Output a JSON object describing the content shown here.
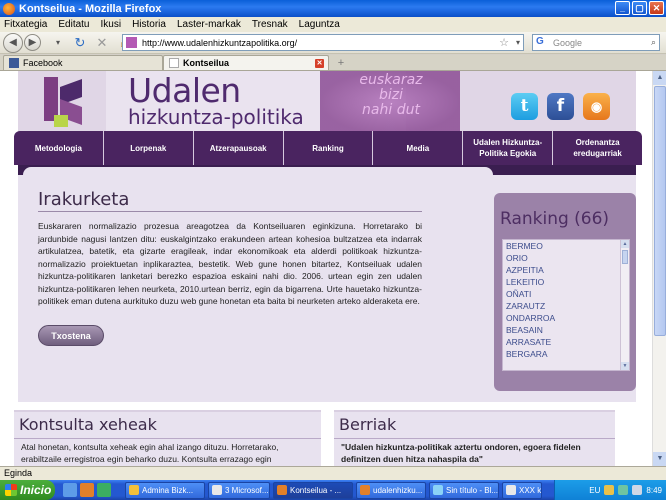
{
  "window": {
    "title": "Kontseilua - Mozilla Firefox"
  },
  "menu": [
    "Fitxategia",
    "Editatu",
    "Ikusi",
    "Historia",
    "Laster-markak",
    "Tresnak",
    "Laguntza"
  ],
  "nav": {
    "url": "http://www.udalenhizkuntzapolitika.org/",
    "search_placeholder": "Google"
  },
  "tabs": [
    {
      "label": "Facebook"
    },
    {
      "label": "Kontseilua"
    }
  ],
  "site": {
    "title": "Udalen",
    "subtitle": "hizkuntza-politika",
    "slogan": [
      "euskaraz",
      "bizi",
      "nahi dut"
    ]
  },
  "mainnav": [
    "Metodologia",
    "Lorpenak",
    "Atzerapausoak",
    "Ranking",
    "Media",
    "Udalen Hizkuntza-Politika Egokia",
    "Ordenantza eredugarriak"
  ],
  "irakurketa": {
    "title": "Irakurketa",
    "body": "Euskararen normalizazio prozesua areagotzea da Kontseiluaren eginkizuna. Horretarako bi jardunbide nagusi lantzen ditu: euskalgintzako erakundeen artean kohesioa bultzatzea eta indarrak artikulatzea, batetik, eta gizarte eragileak, indar ekonomikoak eta alderdi politikoak hizkuntza-normalizazio proiektuetan inplikaraztea, bestetik. Web gune honen bitartez, Kontseiluak udalen hizkuntza-politikaren lanketari berezko espazioa eskaini nahi dio. 2006. urtean egin zen udalen hizkuntza-politikaren lehen neurketa, 2010.urtean berriz, egin da bigarrena. Urte hauetako hizkuntza-politikek eman dutena aurkituko duzu web gune honetan eta baita bi neurketen arteko alderaketa ere.",
    "button": "Txostena"
  },
  "ranking": {
    "title": "Ranking (66)",
    "items": [
      "BERMEO",
      "ORIO",
      "AZPEITIA",
      "LEKEITIO",
      "OÑATI",
      "ZARAUTZ",
      "ONDARROA",
      "BEASAIN",
      "ARRASATE",
      "BERGARA"
    ]
  },
  "kontsulta": {
    "title": "Kontsulta xeheak",
    "body": "Atal honetan, kontsulta xeheak egin ahal izango dituzu. Horretarako, erabiltzaile erregistroa egin beharko duzu. Kontsulta errazago egin"
  },
  "berriak": {
    "title": "Berriak",
    "body": "\"Udalen hizkuntza-politikak aztertu ondoren, egoera fidelen definitzen duen hitza nahaspila da\""
  },
  "status": "Eginda",
  "taskbar": {
    "start": "Inicio",
    "tasks": [
      "Admina Bizk...",
      "3 Microsof...",
      "Kontseilua - ...",
      "udalenhizku...",
      "Sin título - Bl...",
      "XXX kanpai..."
    ],
    "lang": "EU",
    "time": "8:49"
  }
}
